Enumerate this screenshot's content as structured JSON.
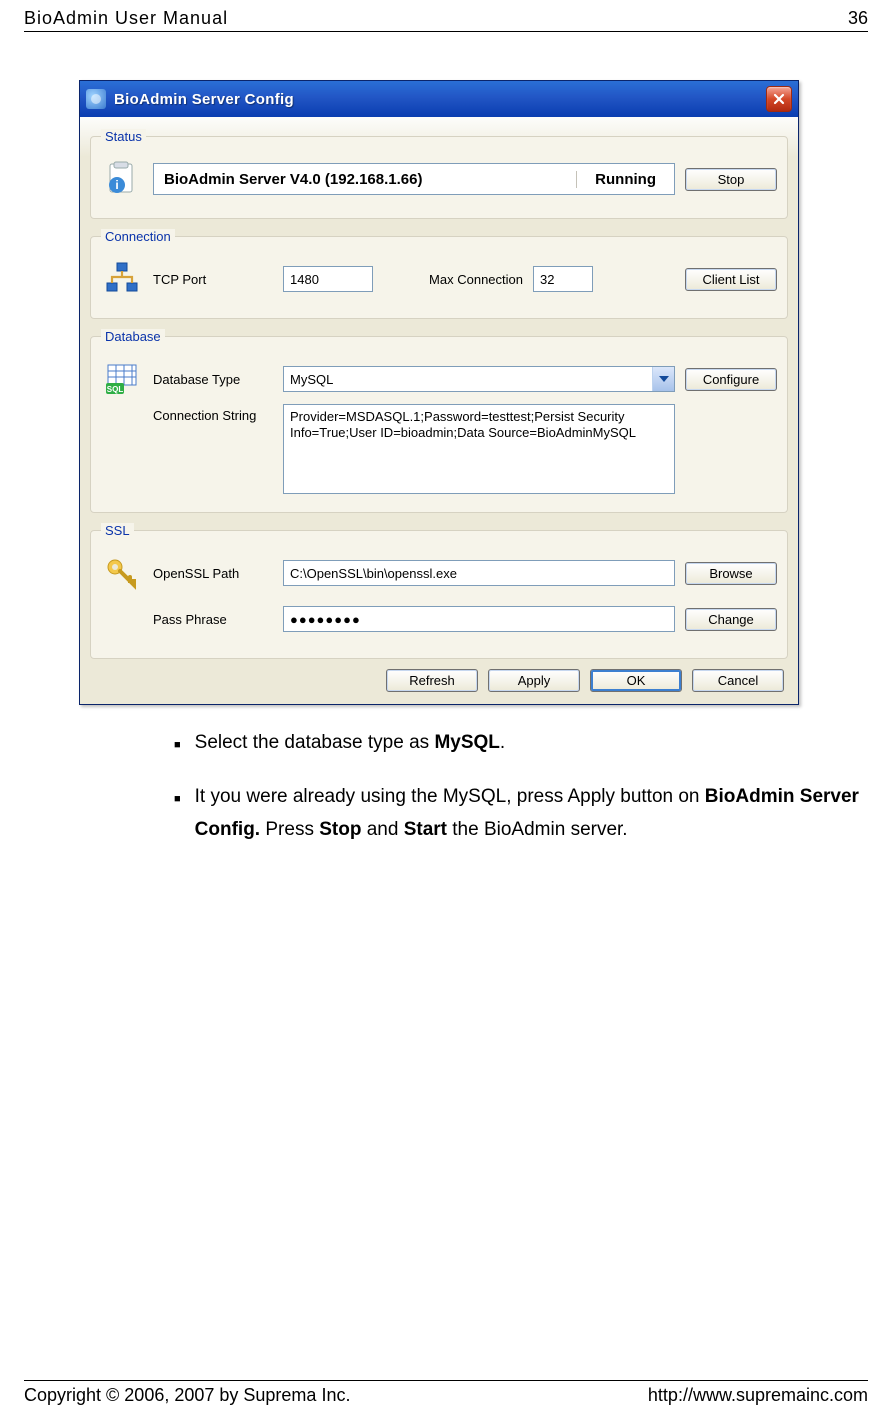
{
  "header": {
    "title": "BioAdmin User Manual",
    "page_no": "36"
  },
  "footer": {
    "copyright": "Copyright © 2006, 2007 by Suprema Inc.",
    "url": "http://www.supremainc.com"
  },
  "dialog": {
    "title": "BioAdmin Server Config",
    "status": {
      "legend": "Status",
      "server": "BioAdmin Server V4.0 (192.168.1.66)",
      "state": "Running",
      "stop_btn": "Stop"
    },
    "connection": {
      "legend": "Connection",
      "tcp_label": "TCP Port",
      "tcp_value": "1480",
      "max_label": "Max Connection",
      "max_value": "32",
      "client_btn": "Client List"
    },
    "database": {
      "legend": "Database",
      "type_label": "Database Type",
      "type_value": "MySQL",
      "configure_btn": "Configure",
      "conn_label": "Connection String",
      "conn_value": "Provider=MSDASQL.1;Password=testtest;Persist Security Info=True;User ID=bioadmin;Data Source=BioAdminMySQL"
    },
    "ssl": {
      "legend": "SSL",
      "path_label": "OpenSSL Path",
      "path_value": "C:\\OpenSSL\\bin\\openssl.exe",
      "browse_btn": "Browse",
      "pass_label": "Pass Phrase",
      "pass_value": "●●●●●●●●",
      "change_btn": "Change"
    },
    "buttons": {
      "refresh": "Refresh",
      "apply": "Apply",
      "ok": "OK",
      "cancel": "Cancel"
    }
  },
  "instructions": {
    "b1_pre": "Select the database type as ",
    "b1_bold": "MySQL",
    "b1_post": ".",
    "b2_pre": "It you were already using the MySQL, press Apply button on ",
    "b2_bold1": "BioAdmin Server Config.",
    "b2_mid": " Press ",
    "b2_bold2": "Stop",
    "b2_and": " and ",
    "b2_bold3": "Start",
    "b2_post": " the BioAdmin server."
  }
}
